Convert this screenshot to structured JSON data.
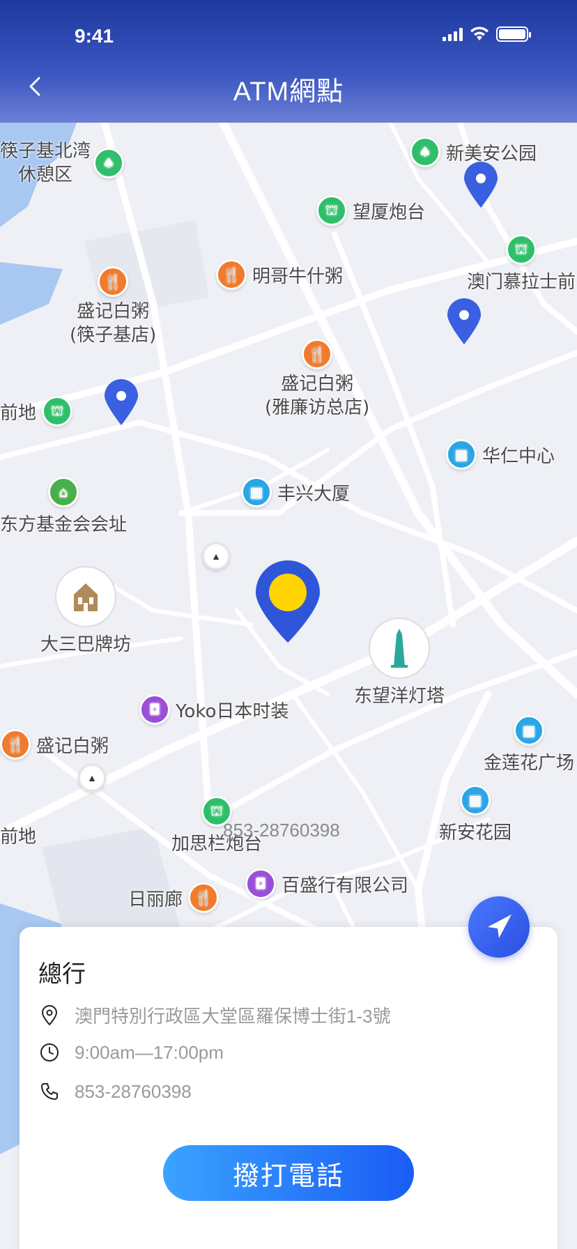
{
  "status_bar": {
    "time": "9:41"
  },
  "header": {
    "title": "ATM網點"
  },
  "map": {
    "pois": {
      "p1": "筷子基北湾\n休憩区",
      "p2": "新美安公园",
      "p3": "望厦炮台",
      "p4": "明哥牛什粥",
      "p5": "盛记白粥\n(筷子基店)",
      "p6": "澳门慕拉士前",
      "p7": "盛记白粥\n(雅廉访总店)",
      "p8": "前地",
      "p9": "华仁中心",
      "p10": "丰兴大厦",
      "p11": "东方基金会会址",
      "p12": "大三巴牌坊",
      "p13": "东望洋灯塔",
      "p14": "Yoko日本时装",
      "p15": "盛记白粥",
      "p16": "金莲花广场",
      "p17": "新安花园",
      "p18": "加思栏炮台",
      "p19": "前地",
      "p20": "百盛行有限公司",
      "p21": "日丽廊"
    },
    "overlay_phone": "853-28760398"
  },
  "card": {
    "title": "總行",
    "address": "澳門特別行政區大堂區羅保博士街1-3號",
    "hours": "9:00am—17:00pm",
    "phone": "853-28760398",
    "call_button": "撥打電話"
  }
}
